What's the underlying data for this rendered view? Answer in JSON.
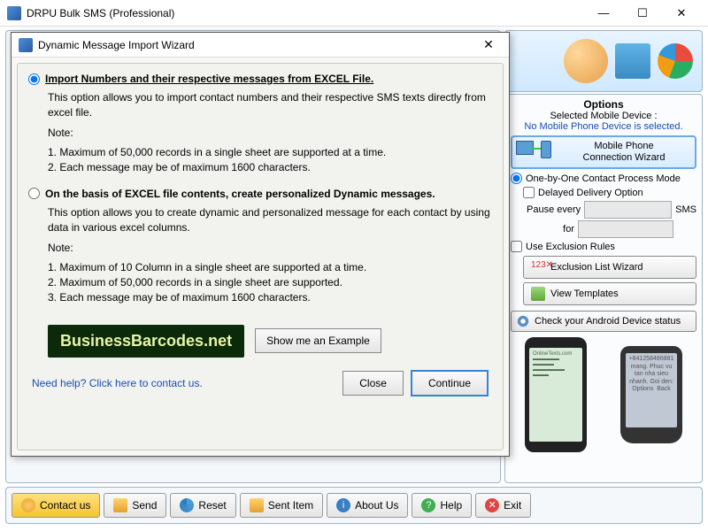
{
  "app": {
    "title": "DRPU Bulk SMS (Professional)",
    "window_buttons": {
      "min": "—",
      "max": "☐",
      "close": "✕"
    }
  },
  "dialog": {
    "title": "Dynamic Message Import Wizard",
    "close_glyph": "✕",
    "option1": {
      "label": "Import Numbers and their respective messages from EXCEL File.",
      "desc": "This option allows you to import contact numbers and their respective SMS texts directly from excel file.",
      "note_label": "Note:",
      "note1": "1. Maximum of 50,000 records in a single sheet are supported at a time.",
      "note2": "2. Each message may be of maximum 1600 characters."
    },
    "option2": {
      "label": "On the basis of EXCEL file contents, create personalized Dynamic messages.",
      "desc": "This option allows you to create dynamic and personalized message for each contact by using data in various excel columns.",
      "note_label": "Note:",
      "note1": "1. Maximum of 10 Column in a single sheet are supported at a time.",
      "note2": "2. Maximum of 50,000 records in a single sheet are supported.",
      "note3": "3. Each message may be of maximum 1600 characters."
    },
    "brand": "BusinessBarcodes.net",
    "example_btn": "Show me an Example",
    "help_link": "Need help? Click here to contact us.",
    "close_btn": "Close",
    "continue_btn": "Continue"
  },
  "options": {
    "title": "Options",
    "selected_label": "Selected Mobile Device :",
    "no_device": "No Mobile Phone Device is selected.",
    "conn_wizard_l1": "Mobile Phone",
    "conn_wizard_l2": "Connection  Wizard",
    "one_by_one": "One-by-One Contact Process Mode",
    "delayed": "Delayed Delivery Option",
    "pause_every": "Pause every",
    "sms_suffix": "SMS",
    "for_label": "for",
    "exclusion": "Use Exclusion Rules",
    "exclusion_wizard": "Exclusion List Wizard",
    "view_templates": "View Templates",
    "android_status": "Check your Android Device status"
  },
  "phone_preview": {
    "phone2_number": "+841258486881",
    "phone2_text": "mang. Phuc vu tan nha sieu nhanh. Goi den:",
    "phone2_options": "Options",
    "phone2_back": "Back"
  },
  "bottombar": {
    "contact": "Contact us",
    "send": "Send",
    "reset": "Reset",
    "sent_item": "Sent Item",
    "about": "About Us",
    "help": "Help",
    "exit": "Exit"
  }
}
